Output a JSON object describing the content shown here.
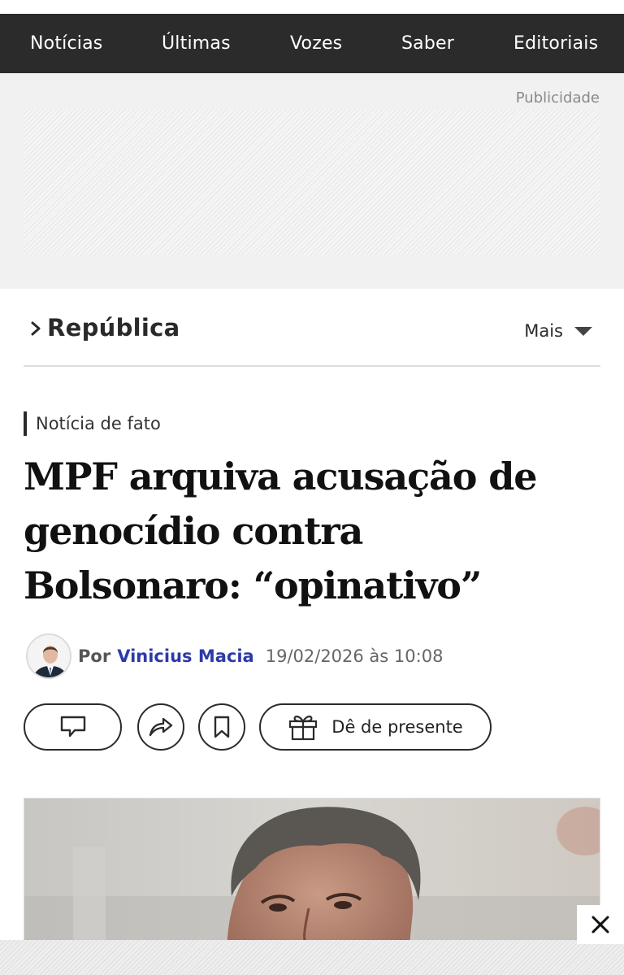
{
  "nav": {
    "items": [
      "Notícias",
      "Últimas",
      "Vozes",
      "Saber",
      "Editoriais"
    ]
  },
  "ad": {
    "label": "Publicidade"
  },
  "section": {
    "title": "República",
    "more_label": "Mais"
  },
  "article": {
    "tag": "Notícia de fato",
    "headline_lines": [
      "MPF arquiva acusação de",
      "genocídio contra",
      "Bolsonaro: “opinativo”"
    ],
    "by_prefix": "Por",
    "author": "Vinicius Macia",
    "date": "19/02/2026 às 10:08"
  },
  "actions": {
    "gift_label": "Dê de presente"
  },
  "icons": {
    "section": "chevron-right-icon",
    "more": "caret-down-icon",
    "comment": "comment-icon",
    "share": "share-icon",
    "bookmark": "bookmark-icon",
    "gift": "gift-icon",
    "close": "close-icon"
  },
  "colors": {
    "nav_bg": "#2b2b2b",
    "author_link": "#2c3aa8",
    "ad_bg": "#f1f1f1"
  }
}
